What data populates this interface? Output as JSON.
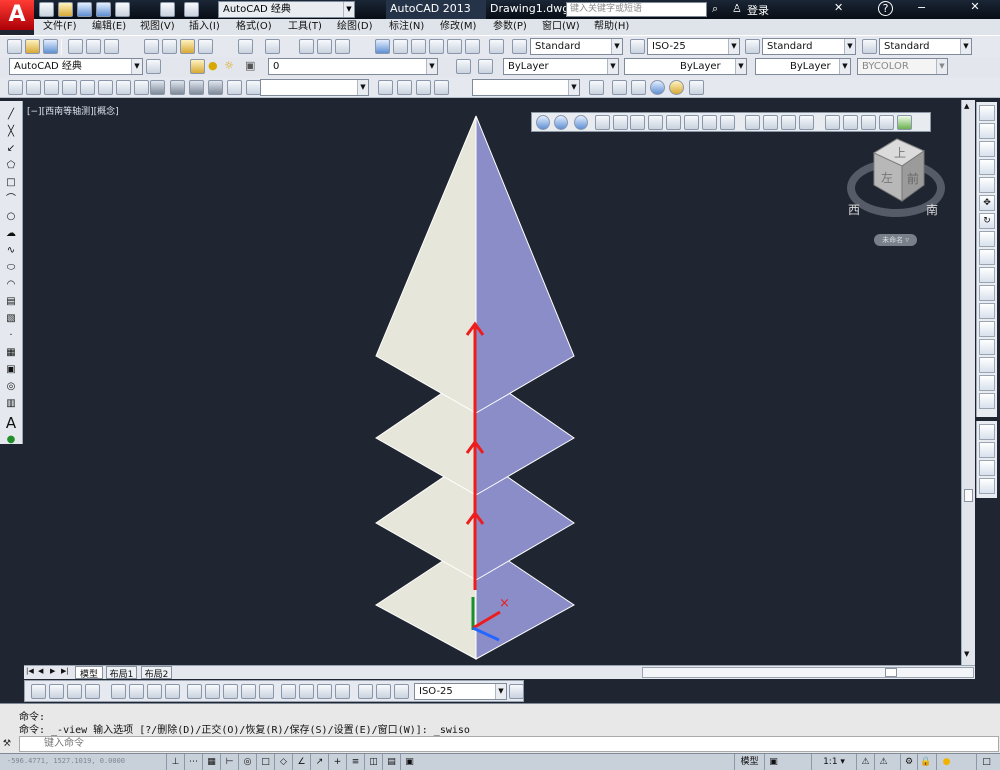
{
  "title": {
    "workspace": "AutoCAD 经典",
    "app": "AutoCAD 2013",
    "document": "Drawing1.dwg",
    "search_placeholder": "键入关键字或短语",
    "login": "登录"
  },
  "menu": [
    "文件(F)",
    "编辑(E)",
    "视图(V)",
    "插入(I)",
    "格式(O)",
    "工具(T)",
    "绘图(D)",
    "标注(N)",
    "修改(M)",
    "参数(P)",
    "窗口(W)",
    "帮助(H)"
  ],
  "styles": {
    "text_style": "Standard",
    "dim_style": "ISO-25",
    "table_style": "Standard",
    "multileader_style": "Standard"
  },
  "layers": {
    "workspace": "AutoCAD 经典",
    "current_layer": "0",
    "color": "ByLayer",
    "linetype": "ByLayer",
    "lineweight": "ByLayer",
    "plot_style": "BYCOLOR"
  },
  "viewport": {
    "label": "[−][西南等轴测][概念]",
    "view_compass": [
      "西",
      "南"
    ],
    "cube_faces": [
      "上",
      "左",
      "前"
    ],
    "unnamed": "未命名 ▿"
  },
  "tabs": [
    "模型",
    "布局1",
    "布局2"
  ],
  "dimension_toolbar": {
    "style": "ISO-25"
  },
  "command": {
    "line1": "命令:",
    "line2": "命令: _-view 输入选项 [?/删除(D)/正交(O)/恢复(R)/保存(S)/设置(E)/窗口(W)]: _swiso",
    "placeholder": "键入命令"
  },
  "status": {
    "coords": "-596.4771, 1527.1019, 0.0000",
    "mode": "模型",
    "scale": "1:1 ▾"
  },
  "colors": {
    "canvas": "#202631",
    "left_face": "#e7e6da",
    "right_face": "#8b8dc8",
    "axis_red": "#ee1d1d",
    "ucs_green": "#1a8f2d",
    "ucs_blue": "#2466ff"
  }
}
